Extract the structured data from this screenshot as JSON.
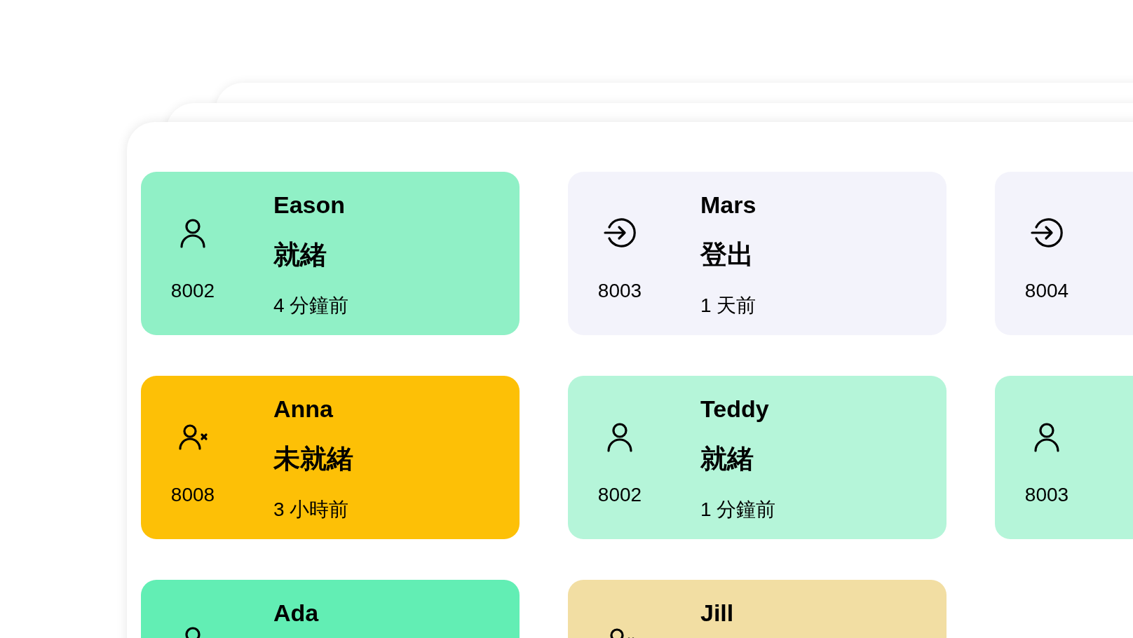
{
  "cards": [
    {
      "kind": "ready",
      "extension": "8002",
      "name": "Eason",
      "status": "就緒",
      "time": "4 分鐘前",
      "color": "#90f0c6"
    },
    {
      "kind": "loggedout",
      "extension": "8003",
      "name": "Mars",
      "status": "登出",
      "time": "1 天前",
      "color": "#f3f3fb"
    },
    {
      "kind": "loggedout",
      "extension": "8004",
      "color": "#f3f3fb"
    },
    {
      "kind": "notready",
      "extension": "8008",
      "name": "Anna",
      "status": "未就緒",
      "time": "3 小時前",
      "color": "#fdc006"
    },
    {
      "kind": "ready",
      "extension": "8002",
      "name": "Teddy",
      "status": "就緒",
      "time": "1 分鐘前",
      "color": "#b5f5d9"
    },
    {
      "kind": "ready",
      "extension": "8003",
      "color": "#b5f5d9"
    },
    {
      "kind": "ready",
      "name": "Ada",
      "color": "#62eeb4"
    },
    {
      "kind": "notready",
      "name": "Jill",
      "color": "#f2dea3"
    }
  ]
}
